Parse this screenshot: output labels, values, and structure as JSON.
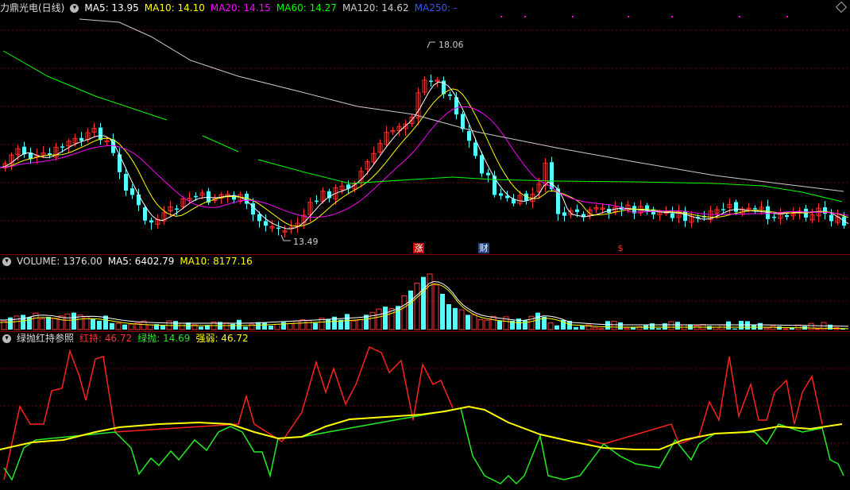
{
  "price_panel": {
    "title": "力鼎光电(日线)",
    "indicators": [
      {
        "label": "MA5: 13.95",
        "color": "#ffffff"
      },
      {
        "label": "MA10: 14.10",
        "color": "#ffff00"
      },
      {
        "label": "MA20: 14.15",
        "color": "#ff00ff"
      },
      {
        "label": "MA60: 14.27",
        "color": "#00ff00"
      },
      {
        "label": "MA120: 14.62",
        "color": "#cccccc"
      },
      {
        "label": "MA250: -",
        "color": "#3355ff"
      }
    ],
    "high_label": "18.06",
    "low_label": "13.49",
    "markers": [
      {
        "text": "涨",
        "bg": "#cc0000"
      },
      {
        "text": "财",
        "bg": "#224488"
      },
      {
        "text": "$",
        "bg": "#000000"
      }
    ]
  },
  "volume_panel": {
    "title": "VOLUME: 1376.00",
    "ma5": "MA5: 6402.79",
    "ma10": "MA10: 8177.16"
  },
  "indicator_panel": {
    "title": "绿抛红持参照",
    "red": "红持: 46.72",
    "green": "绿抛: 14.69",
    "strength": "强弱: 46.72"
  },
  "colors": {
    "up": "#ff3333",
    "down": "#54ffff",
    "red_line": "#ff2020",
    "green_line": "#22ee22",
    "yellow_line": "#ffff00",
    "grid": "#800000"
  }
}
